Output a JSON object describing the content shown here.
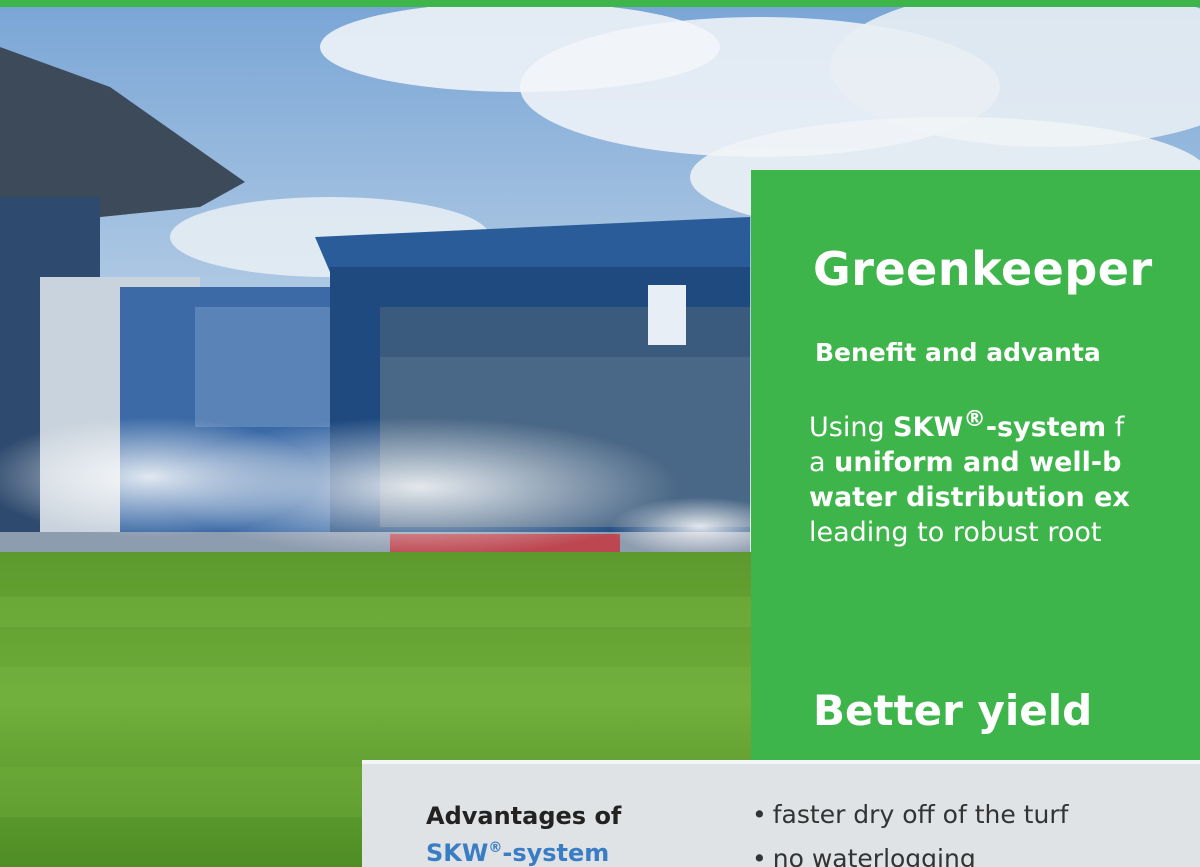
{
  "colors": {
    "accent_green": "#3db54a",
    "brand_blue": "#3b7dc4",
    "panel_gray": "#dfe3e6"
  },
  "hero_image": {
    "subject": "stadium-with-sprinklers"
  },
  "greenkeeper": {
    "title": "Greenkeeper",
    "subtitle": "Benefit and advanta",
    "body_line1_pre": "Using ",
    "body_line1_bold": "SKW",
    "body_line1_sup": "®",
    "body_line1_bold2": "-system",
    "body_line1_post": " f",
    "body_line2_pre": "a ",
    "body_line2_bold": "uniform and well-b",
    "body_line3_bold": "water distribution ex",
    "body_line4": "leading to robust root",
    "yield_title": "Better yield"
  },
  "advantages": {
    "title_line1": "Advantages of",
    "title_brand": "SKW",
    "title_sup": "®",
    "title_suffix": "-system",
    "bullet_symbol": "•",
    "items": [
      "faster dry off of the turf",
      "no waterlogging"
    ]
  }
}
